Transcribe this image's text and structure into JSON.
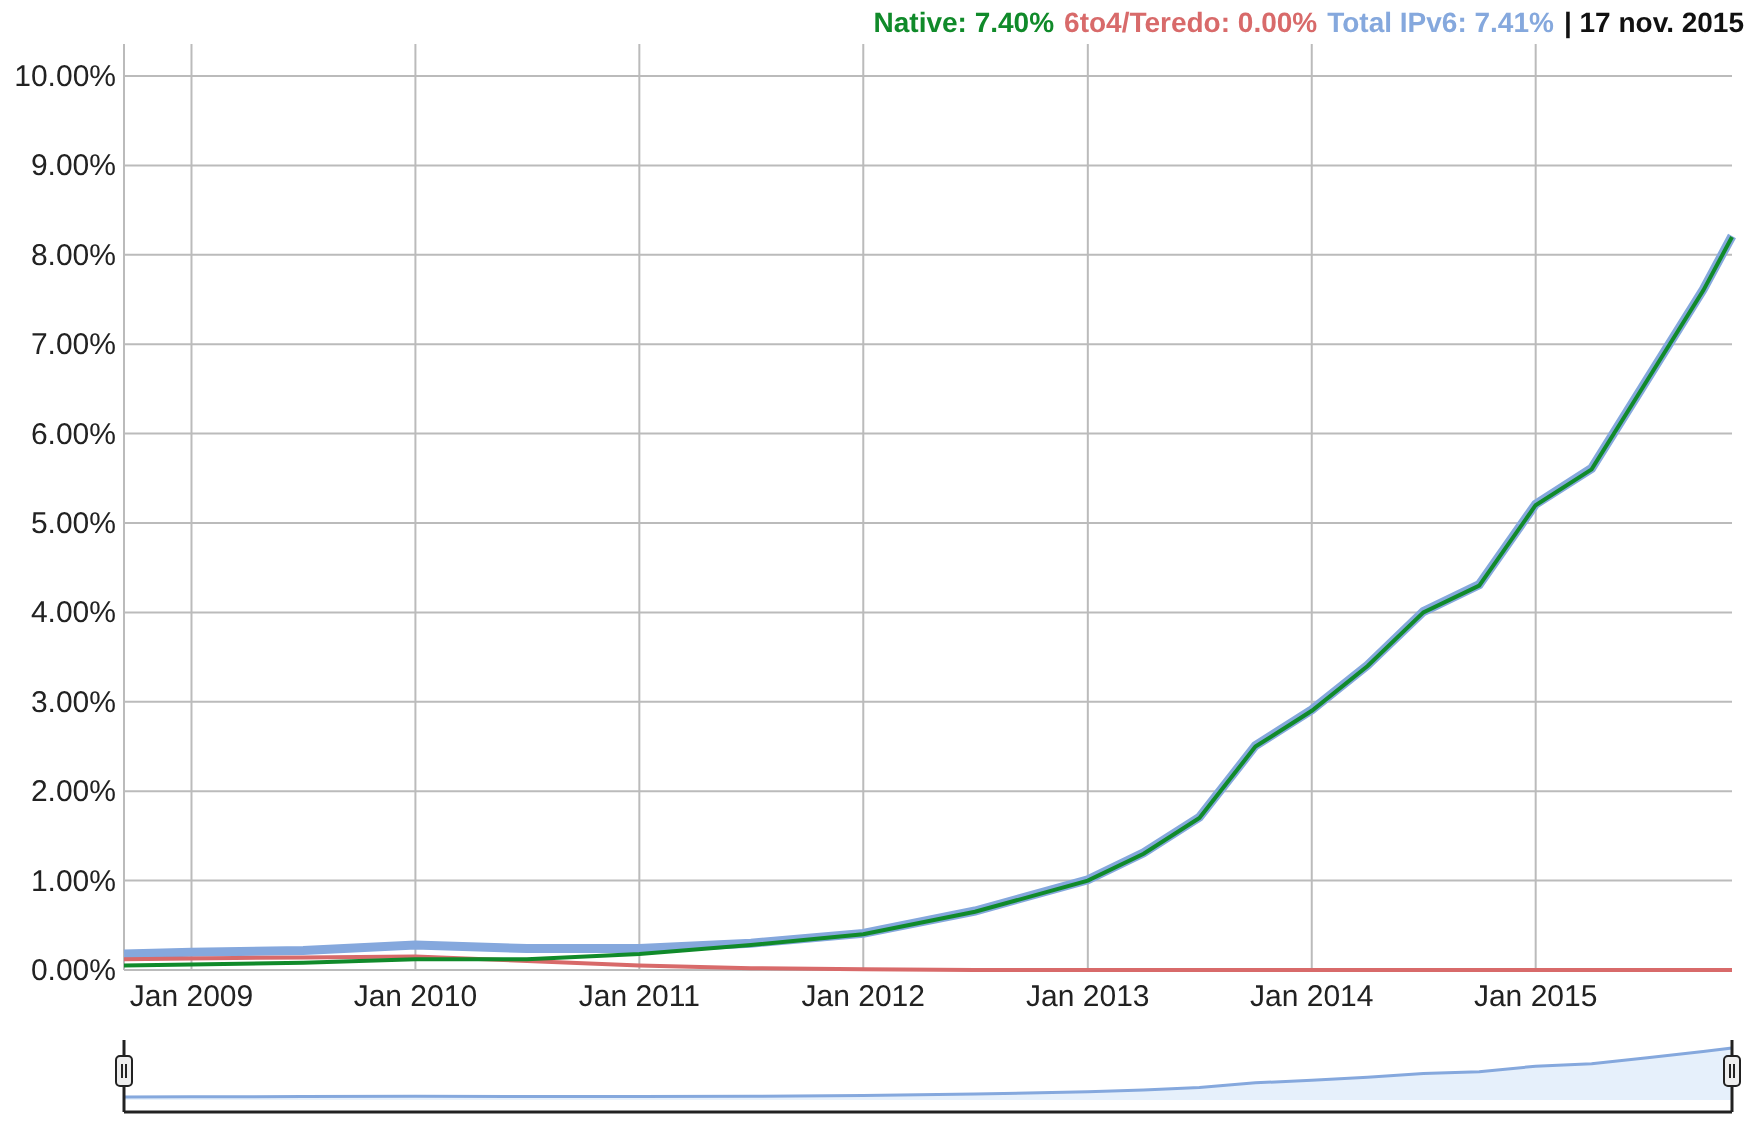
{
  "legend": [
    {
      "text": "Native: 7.40%",
      "color": "#108a2a"
    },
    {
      "text": "6to4/Teredo: 0.00%",
      "color": "#d86a6a"
    },
    {
      "text": "Total IPv6: 7.41%",
      "color": "#85a8dd"
    }
  ],
  "date": "| 17 nov. 2015",
  "chart": {
    "chart_data": {
      "type": "line",
      "x": [
        "2008-09-13",
        "2009-01-01",
        "2009-07-02",
        "2010-01-01",
        "2010-07-02",
        "2011-01-01",
        "2011-07-02",
        "2012-01-01",
        "2012-07-01",
        "2013-01-01",
        "2013-04-02",
        "2013-07-02",
        "2013-10-01",
        "2014-01-01",
        "2014-04-02",
        "2014-07-02",
        "2014-10-01",
        "2015-01-01",
        "2015-04-02",
        "2015-07-02",
        "2015-10-01",
        "2015-11-17"
      ],
      "series": [
        {
          "color": "#108a2a",
          "values": [
            0.05,
            0.06,
            0.08,
            0.12,
            0.12,
            0.18,
            0.28,
            0.4,
            0.65,
            1.0,
            1.3,
            1.7,
            2.5,
            2.9,
            3.4,
            4.0,
            4.3,
            5.2,
            5.6,
            6.6,
            7.6,
            8.2
          ]
        },
        {
          "color": "#d86a6a",
          "values": [
            0.12,
            0.13,
            0.14,
            0.15,
            0.1,
            0.05,
            0.02,
            0.01,
            0,
            0,
            0,
            0,
            0,
            0,
            0,
            0,
            0,
            0,
            0,
            0,
            0,
            0
          ]
        },
        {
          "color": "#85a8dd",
          "values": [
            0.18,
            0.2,
            0.22,
            0.28,
            0.24,
            0.24,
            0.3,
            0.41,
            0.66,
            1.01,
            1.31,
            1.71,
            2.51,
            2.91,
            3.41,
            4.01,
            4.31,
            5.21,
            5.61,
            6.61,
            7.61,
            8.21
          ]
        }
      ],
      "xlim": [
        "2008-09-13",
        "2015-11-17"
      ],
      "ylim": [
        0,
        10
      ],
      "grid": true,
      "xticks": [
        {
          "value": "2009-01-01",
          "label": "Jan 2009"
        },
        {
          "value": "2010-01-01",
          "label": "Jan 2010"
        },
        {
          "value": "2011-01-01",
          "label": "Jan 2011"
        },
        {
          "value": "2012-01-01",
          "label": "Jan 2012"
        },
        {
          "value": "2013-01-01",
          "label": "Jan 2013"
        },
        {
          "value": "2014-01-01",
          "label": "Jan 2014"
        },
        {
          "value": "2015-01-01",
          "label": "Jan 2015"
        }
      ],
      "yticks": [
        {
          "value": 0,
          "label": "0.00%"
        },
        {
          "value": 1,
          "label": "1.00%"
        },
        {
          "value": 2,
          "label": "2.00%"
        },
        {
          "value": 3,
          "label": "3.00%"
        },
        {
          "value": 4,
          "label": "4.00%"
        },
        {
          "value": 5,
          "label": "5.00%"
        },
        {
          "value": 6,
          "label": "6.00%"
        },
        {
          "value": 7,
          "label": "7.00%"
        },
        {
          "value": 8,
          "label": "8.00%"
        },
        {
          "value": 9,
          "label": "9.00%"
        },
        {
          "value": 10,
          "label": "10.00%"
        }
      ]
    }
  }
}
